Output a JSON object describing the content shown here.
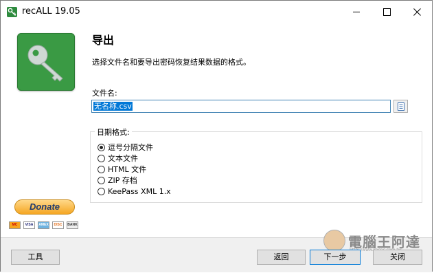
{
  "window": {
    "title": "recALL 19.05",
    "controls": {
      "minimize": "minimize-icon",
      "maximize": "maximize-icon",
      "close": "close-icon"
    }
  },
  "left_panel": {
    "logo_icon": "key-icon",
    "donate_label": "Donate",
    "payment_cards": [
      "MC",
      "VISA",
      "AMEX",
      "DISC",
      "BANK"
    ]
  },
  "main": {
    "heading": "导出",
    "description": "选择文件名和要导出密码恢复结果数据的格式。",
    "file_label": "文件名:",
    "file_value": "无名称.csv",
    "date_group_label": "日期格式:",
    "formats": [
      {
        "label": "逗号分隔文件",
        "selected": true
      },
      {
        "label": "文本文件",
        "selected": false
      },
      {
        "label": "HTML 文件",
        "selected": false
      },
      {
        "label": "ZIP 存档",
        "selected": false
      },
      {
        "label": "KeePass XML 1.x",
        "selected": false
      }
    ]
  },
  "buttons": {
    "tools": "工具",
    "back": "返回",
    "next": "下一步",
    "cancel": "关闭"
  },
  "watermark": {
    "text": "電腦王阿達",
    "url": "http://www.kocpc.com.tw"
  },
  "colors": {
    "accent": "#0078d7",
    "logo_green": "#3a9a44",
    "bottom_bar": "#f0f0f0"
  }
}
